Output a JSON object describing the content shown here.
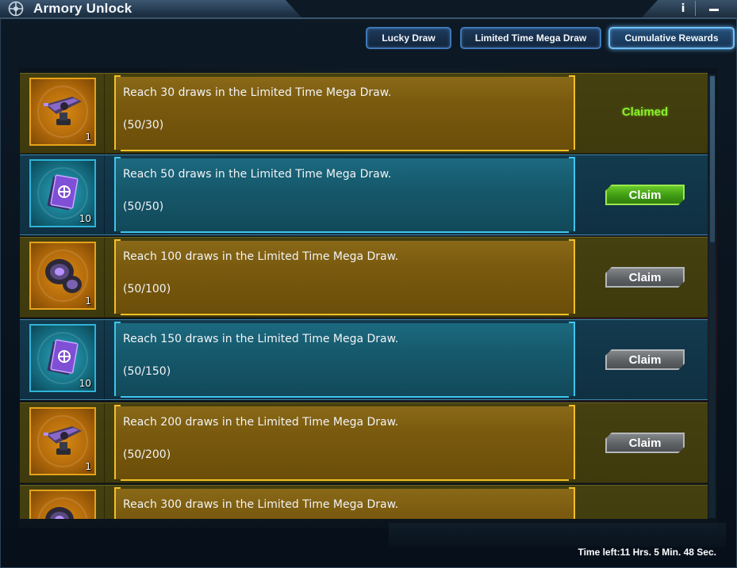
{
  "window": {
    "title": "Armory Unlock",
    "info_glyph": "i"
  },
  "tabs": [
    {
      "label": "Lucky Draw",
      "active": false
    },
    {
      "label": "Limited Time Mega Draw",
      "active": false
    },
    {
      "label": "Cumulative Rewards",
      "active": true
    }
  ],
  "rewards": [
    {
      "style": "gold",
      "item_icon": "turret-icon",
      "quantity": "1",
      "description": "Reach 30 draws in the Limited Time Mega Draw.",
      "progress": "(50/30)",
      "status": "Claimed",
      "button_state": "claimed"
    },
    {
      "style": "blue",
      "item_icon": "blueprint-card-icon",
      "quantity": "10",
      "description": "Reach 50 draws in the Limited Time Mega Draw.",
      "progress": "(50/50)",
      "status": "Claim",
      "button_state": "available"
    },
    {
      "style": "gold",
      "item_icon": "thruster-icon",
      "quantity": "1",
      "description": "Reach 100 draws in the Limited Time Mega Draw.",
      "progress": "(50/100)",
      "status": "Claim",
      "button_state": "disabled"
    },
    {
      "style": "blue",
      "item_icon": "blueprint-card-icon",
      "quantity": "10",
      "description": "Reach 150 draws in the Limited Time Mega Draw.",
      "progress": "(50/150)",
      "status": "Claim",
      "button_state": "disabled"
    },
    {
      "style": "gold",
      "item_icon": "turret-icon",
      "quantity": "1",
      "description": "Reach 200 draws in the Limited Time Mega Draw.",
      "progress": "(50/200)",
      "status": "Claim",
      "button_state": "disabled"
    },
    {
      "style": "gold",
      "item_icon": "thruster-icon",
      "quantity": "",
      "description": "Reach 300 draws in the Limited Time Mega Draw.",
      "progress": "",
      "status": "",
      "button_state": "hidden"
    }
  ],
  "footer": {
    "time_left": "Time left:11 Hrs. 5 Min. 48 Sec."
  },
  "colors": {
    "gold_accent": "#f2c027",
    "blue_accent": "#40c4ee",
    "claimed_text": "#8cf029",
    "claim_green": "#3e9a13",
    "claim_grey": "#5f6265"
  }
}
